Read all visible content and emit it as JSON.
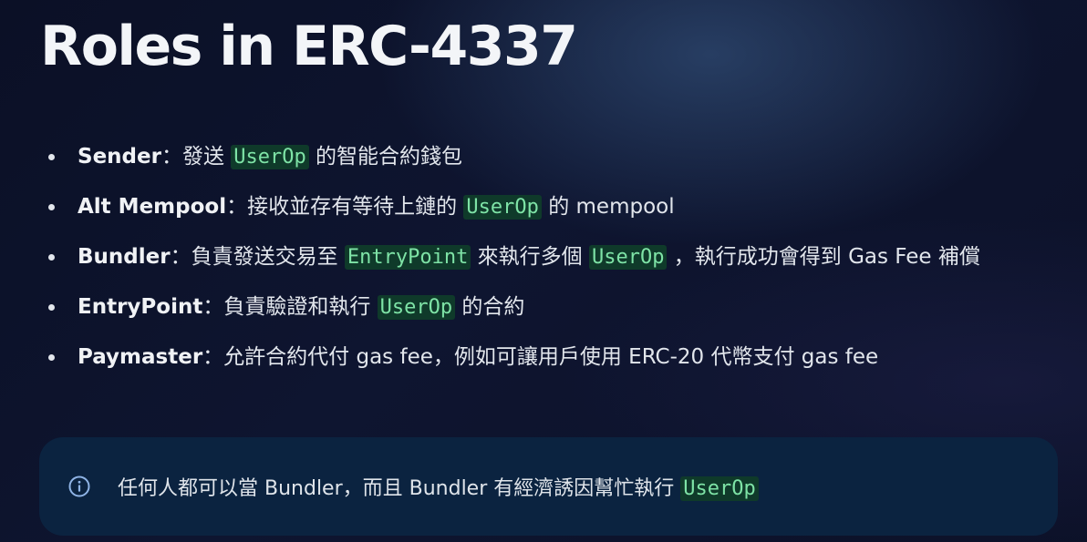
{
  "title": "Roles in ERC-4337",
  "roles": [
    {
      "name": "Sender",
      "sep": "：",
      "parts": [
        "發送 ",
        "UserOp",
        " 的智能合約錢包"
      ]
    },
    {
      "name": "Alt Mempool",
      "sep": "：",
      "parts": [
        "接收並存有等待上鏈的 ",
        "UserOp",
        " 的 mempool"
      ]
    },
    {
      "name": "Bundler",
      "sep": "：",
      "parts": [
        "負責發送交易至 ",
        "EntryPoint",
        " 來執行多個 ",
        "UserOp",
        " ，執行成功會得到 Gas Fee 補償"
      ]
    },
    {
      "name": "EntryPoint",
      "sep": "：",
      "parts": [
        "負責驗證和執行 ",
        "UserOp",
        " 的合約"
      ]
    },
    {
      "name": "Paymaster",
      "sep": "：",
      "parts": [
        "允許合約代付 gas fee，例如可讓用戶使用 ERC-20 代幣支付 gas fee"
      ]
    }
  ],
  "callout": {
    "icon": "info-icon",
    "text": "任何人都可以當 Bundler，而且 Bundler 有經濟誘因幫忙執行 ",
    "code": "UserOp"
  },
  "colors": {
    "code_bg": "#0f3a2a",
    "code_fg": "#7ee3a6",
    "callout_bg": "#0b2340"
  }
}
